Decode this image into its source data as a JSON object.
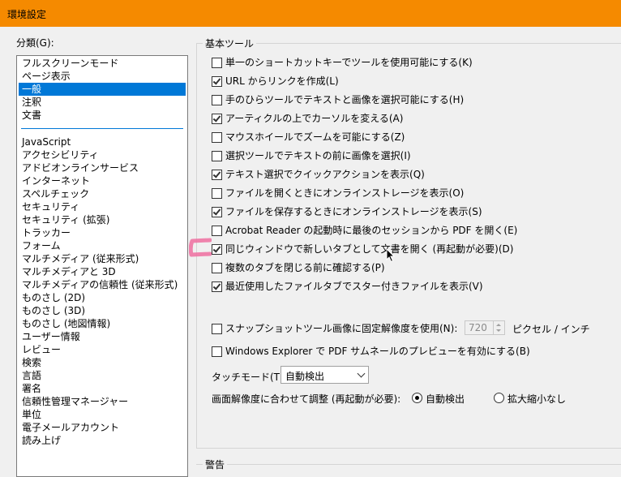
{
  "window": {
    "title": "環境設定"
  },
  "categories": {
    "label": "分類(G):",
    "top_items": [
      {
        "label": "フルスクリーンモード"
      },
      {
        "label": "ページ表示"
      },
      {
        "label": "一般",
        "selected": true
      },
      {
        "label": "注釈"
      },
      {
        "label": "文書"
      }
    ],
    "items": [
      "JavaScript",
      "アクセシビリティ",
      "アドビオンラインサービス",
      "インターネット",
      "スペルチェック",
      "セキュリティ",
      "セキュリティ (拡張)",
      "トラッカー",
      "フォーム",
      "マルチメディア (従来形式)",
      "マルチメディアと 3D",
      "マルチメディアの信頼性 (従来形式)",
      "ものさし (2D)",
      "ものさし (3D)",
      "ものさし (地図情報)",
      "ユーザー情報",
      "レビュー",
      "検索",
      "言語",
      "署名",
      "信頼性管理マネージャー",
      "単位",
      "電子メールアカウント",
      "読み上げ"
    ]
  },
  "basic_tools": {
    "title": "基本ツール",
    "options": [
      {
        "label": "単一のショートカットキーでツールを使用可能にする(K)",
        "checked": false
      },
      {
        "label": "URL からリンクを作成(L)",
        "checked": true
      },
      {
        "label": "手のひらツールでテキストと画像を選択可能にする(H)",
        "checked": false
      },
      {
        "label": "アーティクルの上でカーソルを変える(A)",
        "checked": true
      },
      {
        "label": "マウスホイールでズームを可能にする(Z)",
        "checked": false
      },
      {
        "label": "選択ツールでテキストの前に画像を選択(I)",
        "checked": false
      },
      {
        "label": "テキスト選択でクイックアクションを表示(Q)",
        "checked": true
      },
      {
        "label": "ファイルを開くときにオンラインストレージを表示(O)",
        "checked": false
      },
      {
        "label": "ファイルを保存するときにオンラインストレージを表示(S)",
        "checked": true
      },
      {
        "label": "Acrobat Reader の起動時に最後のセッションから PDF を開く(E)",
        "checked": false
      },
      {
        "label": "同じウィンドウで新しいタブとして文書を開く (再起動が必要)(D)",
        "checked": true
      },
      {
        "label": "複数のタブを閉じる前に確認する(P)",
        "checked": false
      },
      {
        "label": "最近使用したファイルタブでスター付きファイルを表示(V)",
        "checked": true
      }
    ],
    "snapshot": {
      "label": "スナップショットツール画像に固定解像度を使用(N):",
      "checked": false,
      "value": "720",
      "unit": "ピクセル / インチ"
    },
    "thumbnail": {
      "label": "Windows Explorer で PDF サムネールのプレビューを有効にする(B)",
      "checked": false
    },
    "touch_mode": {
      "label": "タッチモード(T):",
      "value": "自動検出"
    },
    "resolution": {
      "label": "画面解像度に合わせて調整 (再起動が必要):",
      "options": [
        {
          "label": "自動検出",
          "selected": true
        },
        {
          "label": "拡大縮小なし",
          "selected": false
        }
      ]
    }
  },
  "warnings": {
    "title": "警告"
  },
  "colors": {
    "titlebar": "#f58a00",
    "selection": "#0078d7",
    "highlight": "#ee6fa0"
  }
}
